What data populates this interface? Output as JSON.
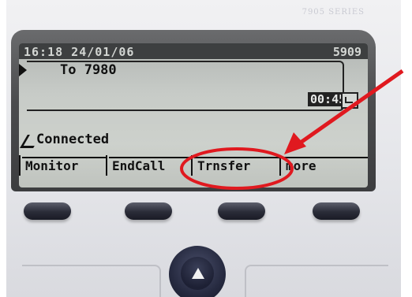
{
  "phone": {
    "series": "7905 SERIES"
  },
  "screen": {
    "datetime": "16:18 24/01/06",
    "extension": "5909",
    "call_to": "To 7980",
    "timer": "00:45",
    "status": "Connected"
  },
  "softkeys": [
    {
      "label": "Monitor"
    },
    {
      "label": "EndCall"
    },
    {
      "label": "Trnsfer"
    },
    {
      "label": "more"
    }
  ],
  "annotation": {
    "color": "#e0191f",
    "highlighted_softkey": "Trnsfer"
  },
  "colors": {
    "lcd_bg": "#c7cbc7",
    "lcd_text": "#111111",
    "bezel": "#4b4c4e",
    "button": "#2a2c38"
  }
}
